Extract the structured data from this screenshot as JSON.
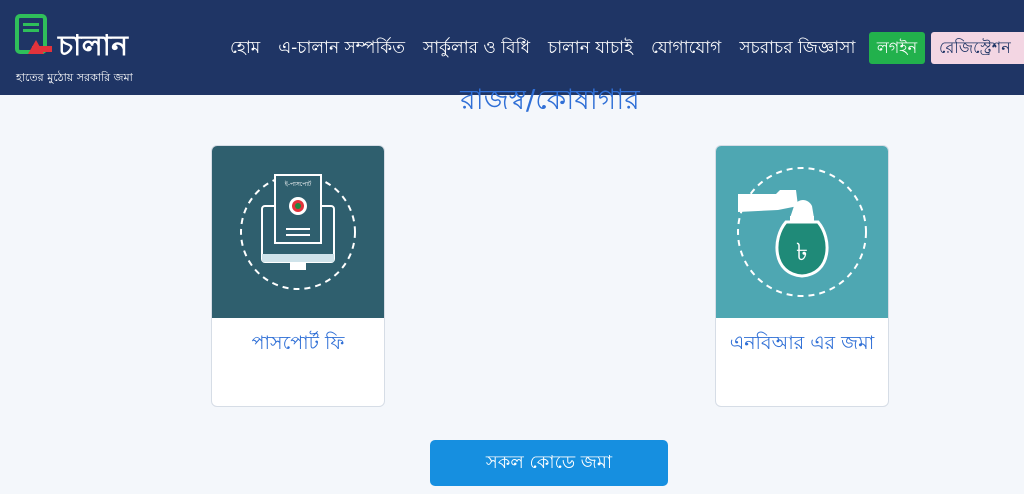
{
  "brand": {
    "name": "চালান",
    "tagline": "হাতের মুঠোয় সরকারি জমা"
  },
  "nav": {
    "items": [
      "হোম",
      "এ-চালান সম্পর্কিত",
      "সার্কুলার ও বিধি",
      "চালান যাচাই",
      "যোগাযোগ",
      "সচরাচর জিজ্ঞাসা"
    ],
    "login_label": "লগইন",
    "register_label": "রেজিস্ট্রেশন"
  },
  "main": {
    "section_title": "রাজস্ব/কোষাগার",
    "cards": [
      {
        "label": "পাসপোর্ট ফি",
        "icon": "passport-computer-icon",
        "icon_text": "ই-পাসপোর্ট"
      },
      {
        "label": "এনবিআর এর জমা",
        "icon": "money-bag-hand-icon",
        "icon_text": "৳"
      }
    ],
    "submit_label": "সকল কোডে জমা"
  },
  "colors": {
    "header_bg": "#1f3565",
    "login_bg": "#22b14c",
    "register_bg": "#f3d6e3",
    "accent": "#2f6fd6",
    "button_bg": "#168fe0",
    "card1_bg": "#2f5f6e",
    "card2_bg": "#4ea7b2"
  }
}
